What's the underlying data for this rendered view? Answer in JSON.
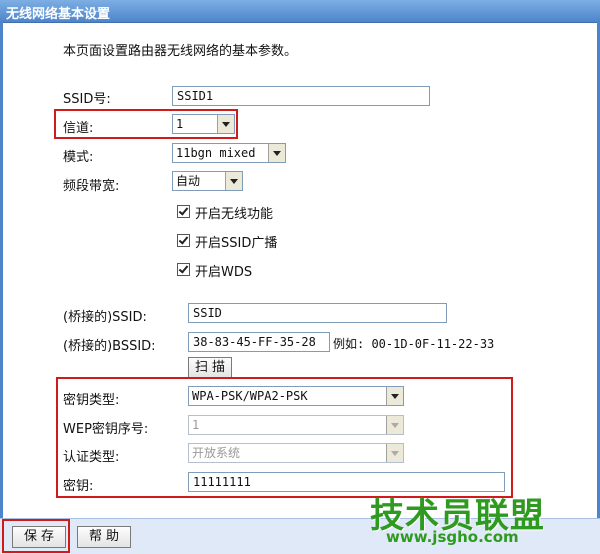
{
  "window": {
    "title": "无线网络基本设置"
  },
  "intro": "本页面设置路由器无线网络的基本参数。",
  "form": {
    "ssid_label": "SSID号:",
    "ssid_value": "SSID1",
    "channel_label": "信道:",
    "channel_value": "1",
    "mode_label": "模式:",
    "mode_value": "11bgn mixed",
    "bandwidth_label": "频段带宽:",
    "bandwidth_value": "自动",
    "enable_wireless_label": "开启无线功能",
    "enable_ssid_broadcast_label": "开启SSID广播",
    "enable_wds_label": "开启WDS",
    "bridge_ssid_label": "(桥接的)SSID:",
    "bridge_ssid_value": "SSID",
    "bridge_bssid_label": "(桥接的)BSSID:",
    "bridge_bssid_value": "38-83-45-FF-35-28",
    "bssid_example": "例如: 00-1D-0F-11-22-33",
    "scan_button": "扫描",
    "key_type_label": "密钥类型:",
    "key_type_value": "WPA-PSK/WPA2-PSK",
    "wep_index_label": "WEP密钥序号:",
    "wep_index_value": "1",
    "auth_type_label": "认证类型:",
    "auth_type_value": "开放系统",
    "key_label": "密钥:",
    "key_value": "11111111"
  },
  "buttons": {
    "save": "保存",
    "help": "帮助"
  },
  "watermark": {
    "main": "技术员联盟",
    "sub": "www.jsgho.com"
  },
  "colors": {
    "highlight": "#d11b1b",
    "title_bar": "#4d85cc",
    "watermark": "#2e9a1f"
  }
}
